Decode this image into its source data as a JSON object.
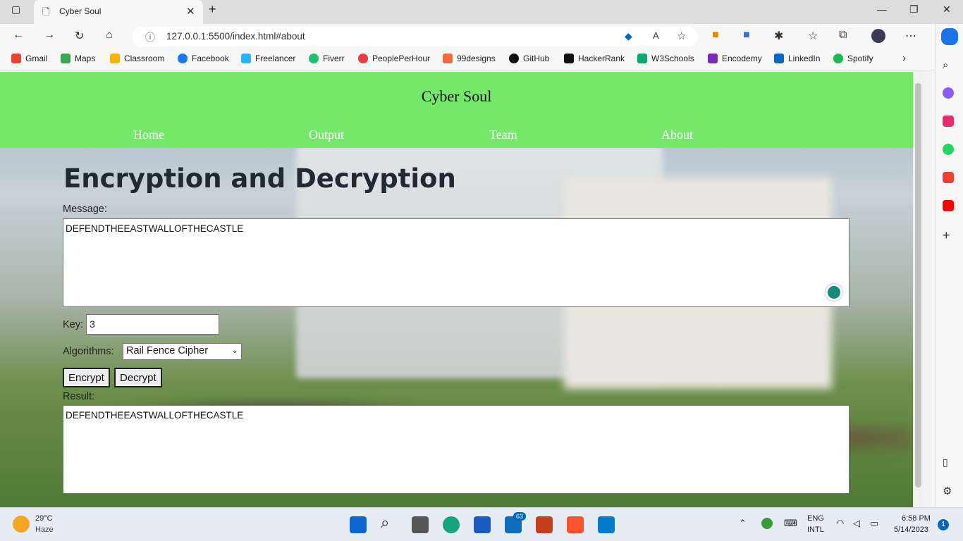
{
  "browser": {
    "tab_title": "Cyber Soul",
    "url": "127.0.0.1:5500/index.html#about"
  },
  "bookmarks": [
    "Gmail",
    "Maps",
    "Classroom",
    "Facebook",
    "Freelancer",
    "Fiverr",
    "PeoplePerHour",
    "99designs",
    "GitHub",
    "HackerRank",
    "W3Schools",
    "Encodemy",
    "LinkedIn",
    "Spotify"
  ],
  "site": {
    "brand": "Cyber Soul",
    "nav": [
      "Home",
      "Output",
      "Team",
      "About"
    ]
  },
  "form": {
    "heading": "Encryption and Decryption",
    "message_label": "Message:",
    "message_value": "DEFENDTHEEASTWALLOFTHECASTLE",
    "key_label": "Key:",
    "key_value": "3",
    "algo_label": "Algorithms:",
    "algo_selected": "Rail Fence Cipher",
    "encrypt_label": "Encrypt",
    "decrypt_label": "Decrypt",
    "result_label": "Result:",
    "result_value": "DEFENDTHEEASTWALLOFTHECASTLE"
  },
  "taskbar": {
    "temp": "29°C",
    "weather": "Haze",
    "mail_badge": "63",
    "lang1": "ENG",
    "lang2": "INTL",
    "time": "6:58 PM",
    "date": "5/14/2023",
    "notif": "1"
  },
  "colors": {
    "header": "#75e86c",
    "accent": "#0067c0"
  }
}
